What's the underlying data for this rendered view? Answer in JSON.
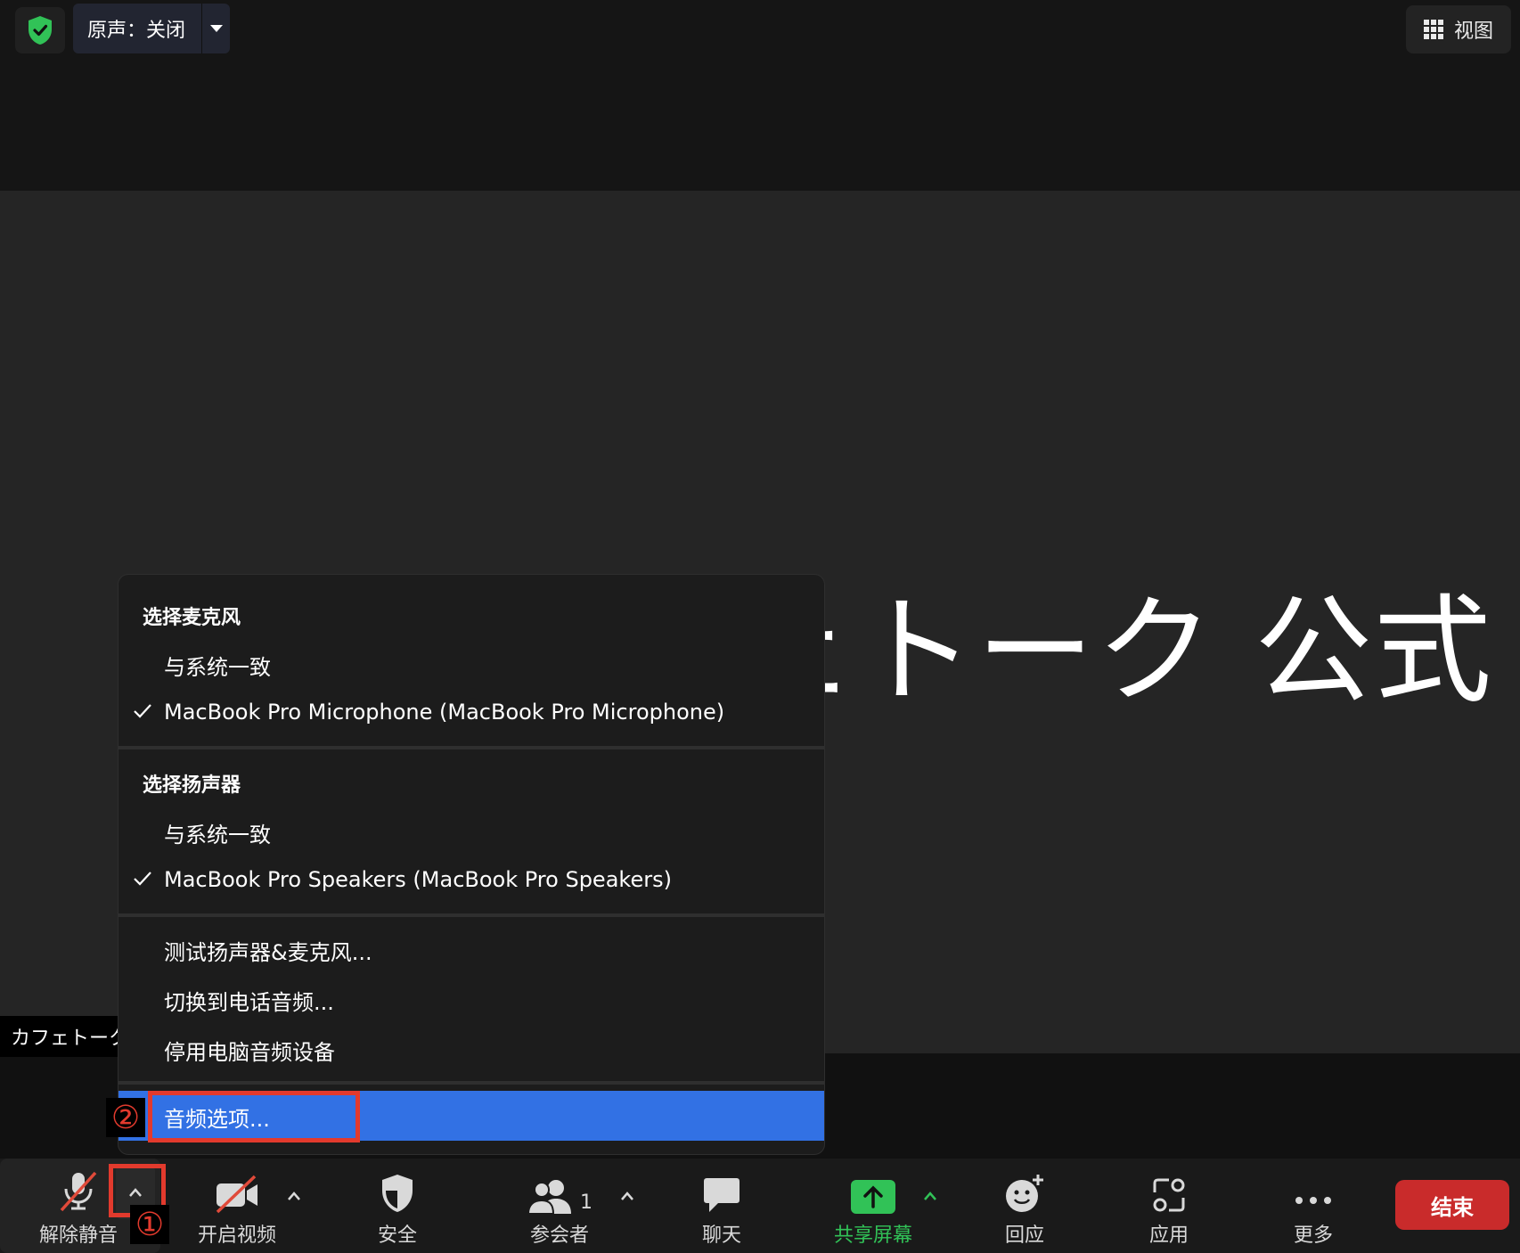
{
  "top_bar": {
    "original_sound_label": "原声：关闭",
    "view_label": "视图"
  },
  "stage": {
    "display_name": "カフェトーク 公式"
  },
  "name_tag": {
    "name": "カフェトーク"
  },
  "audio_menu": {
    "microphone_header": "选择麦克风",
    "mic_same_as_system": "与系统一致",
    "mic_device": "MacBook Pro Microphone (MacBook Pro Microphone)",
    "speaker_header": "选择扬声器",
    "speaker_same_as_system": "与系统一致",
    "speaker_device": "MacBook Pro Speakers (MacBook Pro Speakers)",
    "test_speaker_mic": "测试扬声器&麦克风...",
    "switch_to_phone": "切换到电话音频...",
    "leave_computer_audio": "停用电脑音频设备",
    "audio_options": "音频选项..."
  },
  "annotations": {
    "step1": "①",
    "step2": "②"
  },
  "toolbar": {
    "unmute": "解除静音",
    "start_video": "开启视频",
    "security": "安全",
    "participants": "参会者",
    "participants_count": "1",
    "chat": "聊天",
    "share_screen": "共享屏幕",
    "reactions": "回应",
    "apps": "应用",
    "more": "更多",
    "end": "结束"
  },
  "colors": {
    "accent_blue": "#3271e4",
    "share_green": "#31c257",
    "end_red": "#c92b2b",
    "annotation_red": "#e23a2d"
  }
}
